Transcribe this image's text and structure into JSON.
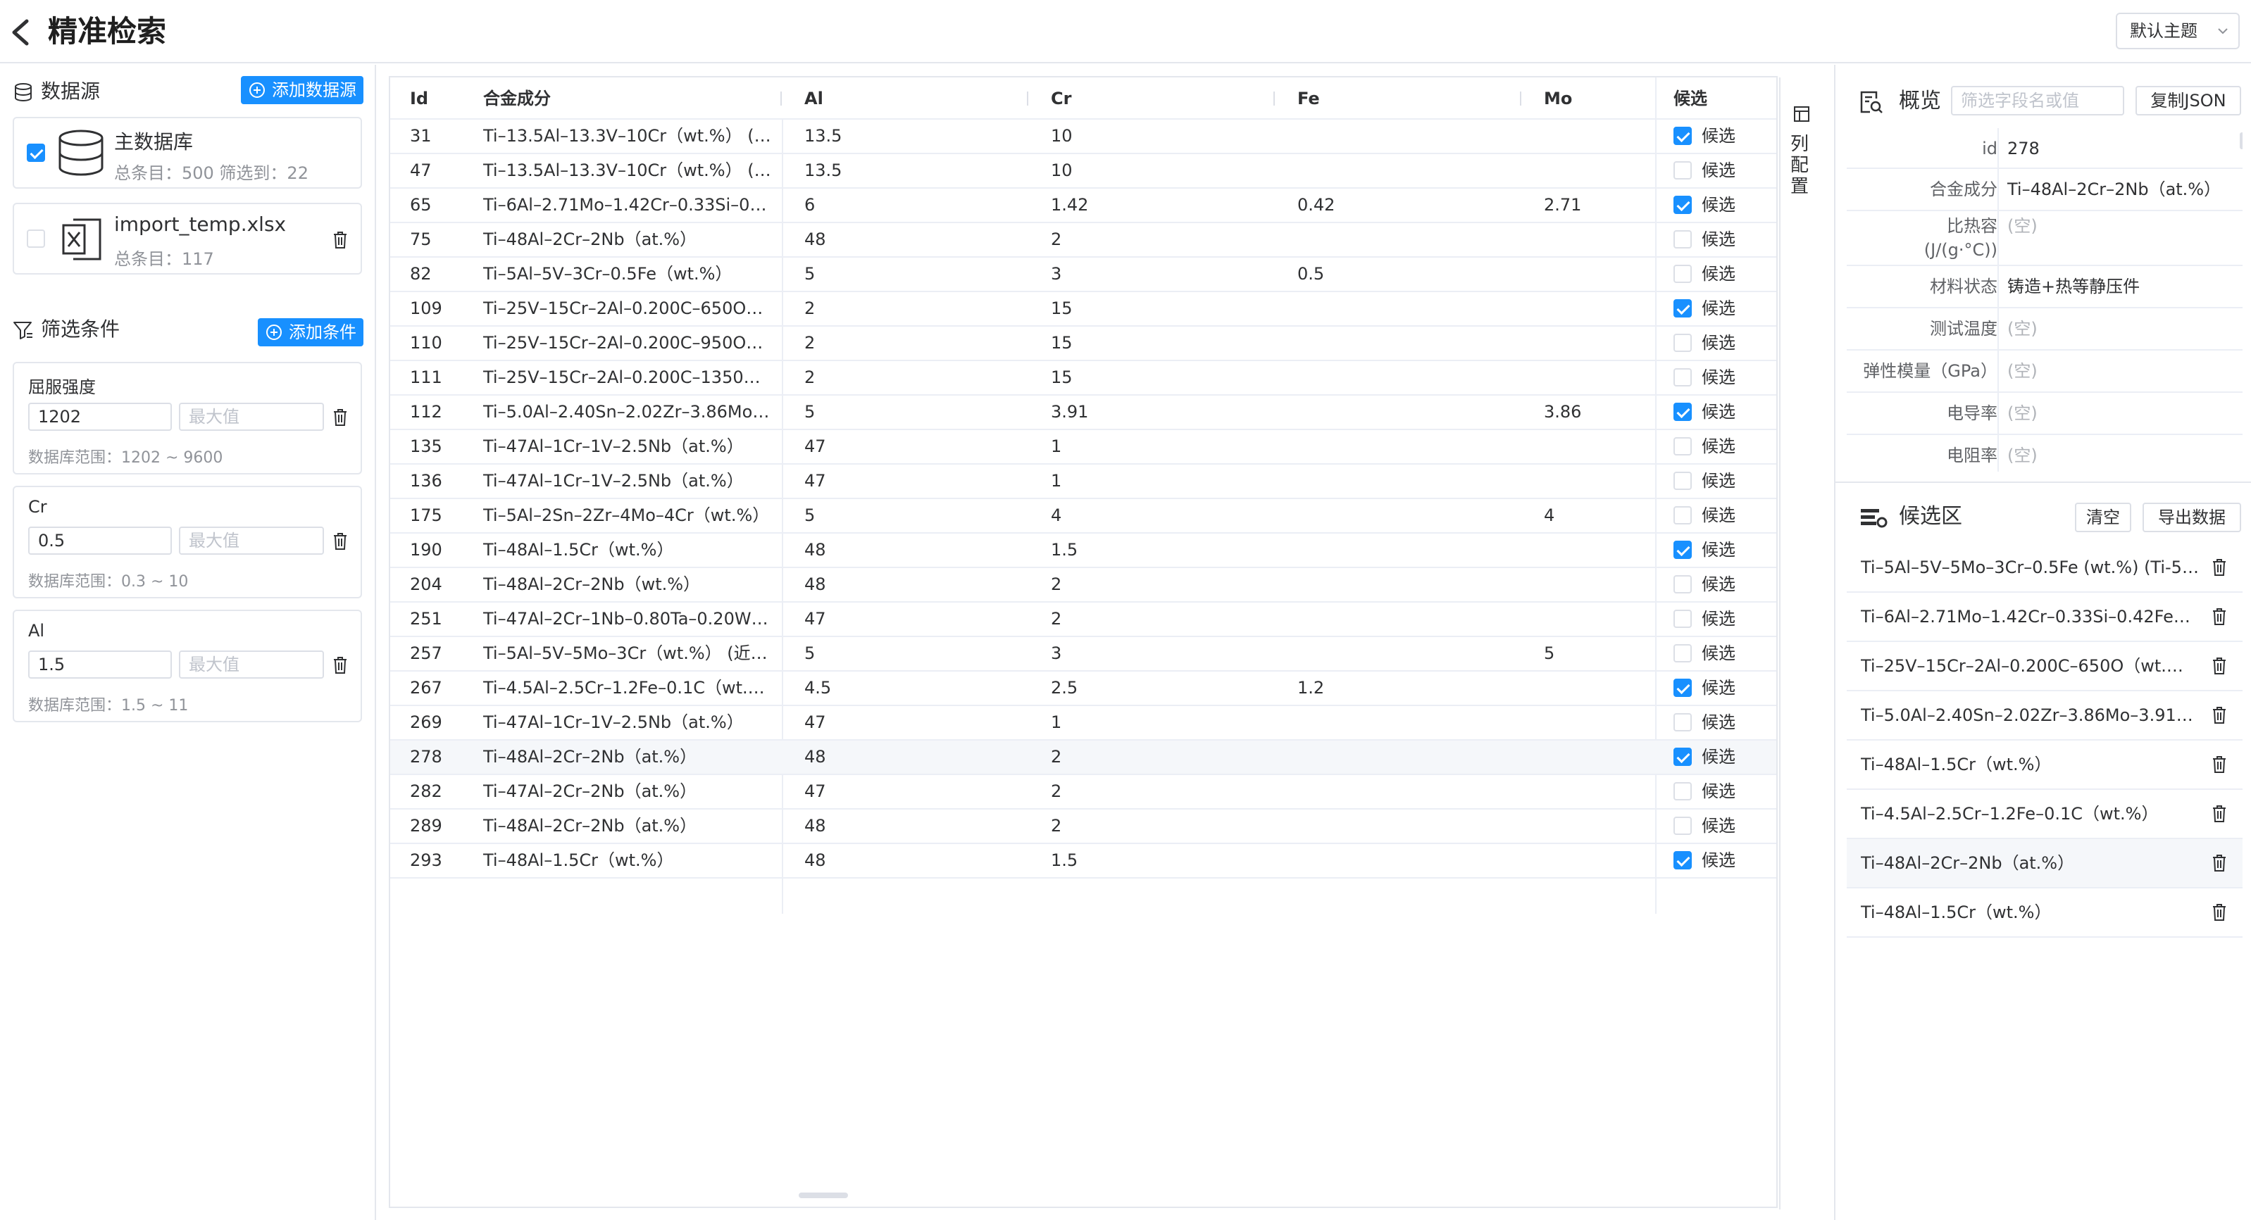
{
  "header": {
    "title": "精准检索",
    "theme": "默认主题"
  },
  "datasource": {
    "title": "数据源",
    "add_label": "添加数据源",
    "items": [
      {
        "name": "主数据库",
        "meta": "总条目：500   筛选到：22",
        "checked": true
      },
      {
        "name": "import_temp.xlsx",
        "meta": "总条目：117",
        "checked": false
      }
    ]
  },
  "filters": {
    "title": "筛选条件",
    "add_label": "添加条件",
    "max_placeholder": "最大值",
    "items": [
      {
        "label": "屈服强度",
        "min": "1202",
        "range": "数据库范围：1202 ~ 9600"
      },
      {
        "label": "Cr",
        "min": "0.5",
        "range": "数据库范围：0.3 ~ 10"
      },
      {
        "label": "Al",
        "min": "1.5",
        "range": "数据库范围：1.5 ~ 11"
      }
    ]
  },
  "table": {
    "columns": [
      "Id",
      "合金成分",
      "Al",
      "Cr",
      "Fe",
      "Mo",
      "候选"
    ],
    "candidate_label": "候选",
    "column_config": "列配置",
    "rows": [
      {
        "id": "31",
        "comp": "Ti–13.5Al–13.3V–10Cr（wt.%） (3...",
        "al": "13.5",
        "cr": "10",
        "fe": "",
        "mo": "",
        "checked": true
      },
      {
        "id": "47",
        "comp": "Ti–13.5Al–13.3V–10Cr（wt.%） (3...",
        "al": "13.5",
        "cr": "10",
        "fe": "",
        "mo": "",
        "checked": false
      },
      {
        "id": "65",
        "comp": "Ti–6Al–2.71Mo–1.42Cr–0.33Si–0.42...",
        "al": "6",
        "cr": "1.42",
        "fe": "0.42",
        "mo": "2.71",
        "checked": true
      },
      {
        "id": "75",
        "comp": "Ti–48Al–2Cr–2Nb（at.%）",
        "al": "48",
        "cr": "2",
        "fe": "",
        "mo": "",
        "checked": false
      },
      {
        "id": "82",
        "comp": "Ti–5Al–5V–3Cr–0.5Fe（wt.%）",
        "al": "5",
        "cr": "3",
        "fe": "0.5",
        "mo": "",
        "checked": false
      },
      {
        "id": "109",
        "comp": "Ti–25V–15Cr–2Al–0.200C–650O（w...",
        "al": "2",
        "cr": "15",
        "fe": "",
        "mo": "",
        "checked": true
      },
      {
        "id": "110",
        "comp": "Ti–25V–15Cr–2Al–0.200C–950O（w...",
        "al": "2",
        "cr": "15",
        "fe": "",
        "mo": "",
        "checked": false
      },
      {
        "id": "111",
        "comp": "Ti–25V–15Cr–2Al–0.200C–1350O（...",
        "al": "2",
        "cr": "15",
        "fe": "",
        "mo": "",
        "checked": false
      },
      {
        "id": "112",
        "comp": "Ti–5.0Al–2.40Sn–2.02Zr–3.86Mo–3....",
        "al": "5",
        "cr": "3.91",
        "fe": "",
        "mo": "3.86",
        "checked": true
      },
      {
        "id": "135",
        "comp": "Ti–47Al–1Cr–1V–2.5Nb（at.%）",
        "al": "47",
        "cr": "1",
        "fe": "",
        "mo": "",
        "checked": false
      },
      {
        "id": "136",
        "comp": "Ti–47Al–1Cr–1V–2.5Nb（at.%）",
        "al": "47",
        "cr": "1",
        "fe": "",
        "mo": "",
        "checked": false
      },
      {
        "id": "175",
        "comp": "Ti–5Al–2Sn–2Zr–4Mo–4Cr（wt.%）",
        "al": "5",
        "cr": "4",
        "fe": "",
        "mo": "4",
        "checked": false
      },
      {
        "id": "190",
        "comp": "Ti–48Al–1.5Cr（wt.%）",
        "al": "48",
        "cr": "1.5",
        "fe": "",
        "mo": "",
        "checked": true
      },
      {
        "id": "204",
        "comp": "Ti–48Al–2Cr–2Nb（wt.%）",
        "al": "48",
        "cr": "2",
        "fe": "",
        "mo": "",
        "checked": false
      },
      {
        "id": "251",
        "comp": "Ti–47Al–2Cr–1Nb–0.80Ta–0.20W–0....",
        "al": "47",
        "cr": "2",
        "fe": "",
        "mo": "",
        "checked": false
      },
      {
        "id": "257",
        "comp": "Ti–5Al–5V–5Mo–3Cr（wt.%） (近β...",
        "al": "5",
        "cr": "3",
        "fe": "",
        "mo": "5",
        "checked": false
      },
      {
        "id": "267",
        "comp": "Ti–4.5Al–2.5Cr–1.2Fe–0.1C（wt.%）",
        "al": "4.5",
        "cr": "2.5",
        "fe": "1.2",
        "mo": "",
        "checked": true
      },
      {
        "id": "269",
        "comp": "Ti–47Al–1Cr–1V–2.5Nb（at.%）",
        "al": "47",
        "cr": "1",
        "fe": "",
        "mo": "",
        "checked": false
      },
      {
        "id": "278",
        "comp": "Ti–48Al–2Cr–2Nb（at.%）",
        "al": "48",
        "cr": "2",
        "fe": "",
        "mo": "",
        "checked": true
      },
      {
        "id": "282",
        "comp": "Ti–47Al–2Cr–2Nb（at.%）",
        "al": "47",
        "cr": "2",
        "fe": "",
        "mo": "",
        "checked": false
      },
      {
        "id": "289",
        "comp": "Ti–48Al–2Cr–2Nb（at.%）",
        "al": "48",
        "cr": "2",
        "fe": "",
        "mo": "",
        "checked": false
      },
      {
        "id": "293",
        "comp": "Ti–48Al–1.5Cr（wt.%）",
        "al": "48",
        "cr": "1.5",
        "fe": "",
        "mo": "",
        "checked": true
      }
    ],
    "highlighted_id": "278"
  },
  "overview": {
    "title": "概览",
    "filter_placeholder": "筛选字段名或值",
    "copy_label": "复制JSON",
    "fields": [
      {
        "key": "id",
        "value": "278",
        "empty": false
      },
      {
        "key": "合金成分",
        "value": "Ti–48Al–2Cr–2Nb（at.%）",
        "empty": false
      },
      {
        "key": "比热容\n(J/(g·°C))",
        "value": "(空)",
        "empty": true
      },
      {
        "key": "材料状态",
        "value": "铸造+热等静压件",
        "empty": false
      },
      {
        "key": "测试温度",
        "value": "(空)",
        "empty": true
      },
      {
        "key": "弹性模量（GPa）",
        "value": "(空)",
        "empty": true
      },
      {
        "key": "电导率",
        "value": "(空)",
        "empty": true
      },
      {
        "key": "电阻率",
        "value": "(空)",
        "empty": true
      }
    ]
  },
  "candidates": {
    "title": "候选区",
    "clear_label": "清空",
    "export_label": "导出数据",
    "items": [
      "Ti–5Al–5V–5Mo–3Cr–0.5Fe (wt.%) (Ti-5553...",
      "Ti–6Al–2.71Mo–1.42Cr–0.33Si–0.42Fe（wt.%...",
      "Ti–25V–15Cr–2Al–0.200C–650O（wt.%） (...",
      "Ti–5.0Al–2.40Sn–2.02Zr–3.86Mo–3.91Cr（wt....",
      "Ti–48Al–1.5Cr（wt.%）",
      "Ti–4.5Al–2.5Cr–1.2Fe–0.1C（wt.%）",
      "Ti–48Al–2Cr–2Nb（at.%）",
      "Ti–48Al–1.5Cr（wt.%）"
    ],
    "highlighted_index": 6
  },
  "colors": {
    "primary": "#1890ff",
    "border": "#e4e7ed",
    "row_highlight": "#f5f7fa"
  }
}
